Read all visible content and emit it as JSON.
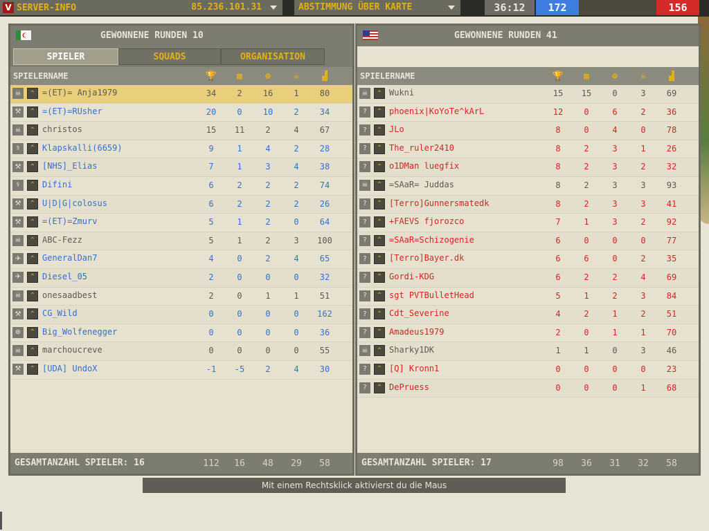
{
  "topbar": {
    "server_label": "SERVER-INFO",
    "server_ip": "85.236.101.31",
    "vote_label": "ABSTIMMUNG ÜBER KARTE",
    "timer": "36:12",
    "score_blue": "172",
    "score_red": "156"
  },
  "left": {
    "title": "GEWONNENE RUNDEN 10",
    "tabs": [
      "SPIELER",
      "SQUADS",
      "ORGANISATION"
    ],
    "col_name": "SPIELERNAME",
    "footer_label": "GESAMTANZAHL SPIELER: 16",
    "footer_values": [
      "112",
      "16",
      "48",
      "29",
      "58"
    ],
    "players": [
      {
        "name": "=(ET)= Anja1979",
        "vals": [
          "34",
          "2",
          "16",
          "1",
          "80"
        ],
        "color": "gray",
        "kit": "skull"
      },
      {
        "name": "=(ET)=RUsher",
        "vals": [
          "20",
          "0",
          "10",
          "2",
          "34"
        ],
        "color": "blue",
        "kit": "wrench"
      },
      {
        "name": "christos",
        "vals": [
          "15",
          "11",
          "2",
          "4",
          "67"
        ],
        "color": "gray",
        "kit": "skull"
      },
      {
        "name": "Klapskalli(6659)",
        "vals": [
          "9",
          "1",
          "4",
          "2",
          "28"
        ],
        "color": "blue",
        "kit": "med"
      },
      {
        "name": "[NHS]_Elias",
        "vals": [
          "7",
          "1",
          "3",
          "4",
          "38"
        ],
        "color": "blue",
        "kit": "wrench"
      },
      {
        "name": "Difini",
        "vals": [
          "6",
          "2",
          "2",
          "2",
          "74"
        ],
        "color": "blue",
        "kit": "med"
      },
      {
        "name": "U|D|G|colosus",
        "vals": [
          "6",
          "2",
          "2",
          "2",
          "26"
        ],
        "color": "blue",
        "kit": "wrench"
      },
      {
        "name": "=(ET)=Zmurv",
        "vals": [
          "5",
          "1",
          "2",
          "0",
          "64"
        ],
        "color": "blue",
        "kit": "wrench"
      },
      {
        "name": "ABC-Fezz",
        "vals": [
          "5",
          "1",
          "2",
          "3",
          "100"
        ],
        "color": "gray",
        "kit": "skull"
      },
      {
        "name": "GeneralDan7",
        "vals": [
          "4",
          "0",
          "2",
          "4",
          "65"
        ],
        "color": "blue",
        "kit": "plane"
      },
      {
        "name": "Diesel_05",
        "vals": [
          "2",
          "0",
          "0",
          "0",
          "32"
        ],
        "color": "blue",
        "kit": "plane"
      },
      {
        "name": "onesaadbest",
        "vals": [
          "2",
          "0",
          "1",
          "1",
          "51"
        ],
        "color": "gray",
        "kit": "skull"
      },
      {
        "name": "CG_Wild",
        "vals": [
          "0",
          "0",
          "0",
          "0",
          "162"
        ],
        "color": "blue",
        "kit": "wrench"
      },
      {
        "name": "Big_Wolfenegger",
        "vals": [
          "0",
          "0",
          "0",
          "0",
          "36"
        ],
        "color": "blue",
        "kit": "target"
      },
      {
        "name": "marchoucreve",
        "vals": [
          "0",
          "0",
          "0",
          "0",
          "55"
        ],
        "color": "gray",
        "kit": "skull"
      },
      {
        "name": "[UDA] UndoX",
        "vals": [
          "-1",
          "-5",
          "2",
          "4",
          "30"
        ],
        "color": "blue",
        "kit": "wrench"
      }
    ]
  },
  "right": {
    "title": "GEWONNENE RUNDEN 41",
    "col_name": "SPIELERNAME",
    "footer_label": "GESAMTANZAHL SPIELER: 17",
    "footer_values": [
      "98",
      "36",
      "31",
      "32",
      "58"
    ],
    "players": [
      {
        "name": "Wukni",
        "vals": [
          "15",
          "15",
          "0",
          "3",
          "69"
        ],
        "color": "gray",
        "kit": "skull"
      },
      {
        "name": "phoenix|KoYoTe^kArL",
        "vals": [
          "12",
          "0",
          "6",
          "2",
          "36"
        ],
        "color": "red",
        "kit": "unknown"
      },
      {
        "name": "JLo",
        "vals": [
          "8",
          "0",
          "4",
          "0",
          "78"
        ],
        "color": "red",
        "kit": "unknown"
      },
      {
        "name": "The_ruler2410",
        "vals": [
          "8",
          "2",
          "3",
          "1",
          "26"
        ],
        "color": "red",
        "kit": "unknown"
      },
      {
        "name": "o1DMan luegfix",
        "vals": [
          "8",
          "2",
          "3",
          "2",
          "32"
        ],
        "color": "red",
        "kit": "unknown"
      },
      {
        "name": "=SAaR= Juddas",
        "vals": [
          "8",
          "2",
          "3",
          "3",
          "93"
        ],
        "color": "gray",
        "kit": "skull"
      },
      {
        "name": "[Terro]Gunnersmatedk",
        "vals": [
          "8",
          "2",
          "3",
          "3",
          "41"
        ],
        "color": "red",
        "kit": "unknown"
      },
      {
        "name": "+FAEVS fjorozco",
        "vals": [
          "7",
          "1",
          "3",
          "2",
          "92"
        ],
        "color": "red",
        "kit": "unknown"
      },
      {
        "name": "=SAaR=Schizogenie",
        "vals": [
          "6",
          "0",
          "0",
          "0",
          "77"
        ],
        "color": "red",
        "kit": "unknown"
      },
      {
        "name": "[Terro]Bayer.dk",
        "vals": [
          "6",
          "6",
          "0",
          "2",
          "35"
        ],
        "color": "red",
        "kit": "unknown"
      },
      {
        "name": "Gordi-KDG",
        "vals": [
          "6",
          "2",
          "2",
          "4",
          "69"
        ],
        "color": "red",
        "kit": "unknown"
      },
      {
        "name": "sgt PVTBulletHead",
        "vals": [
          "5",
          "1",
          "2",
          "3",
          "84"
        ],
        "color": "red",
        "kit": "unknown"
      },
      {
        "name": "Cdt_Severine",
        "vals": [
          "4",
          "2",
          "1",
          "2",
          "51"
        ],
        "color": "red",
        "kit": "unknown"
      },
      {
        "name": "Amadeus1979",
        "vals": [
          "2",
          "0",
          "1",
          "1",
          "70"
        ],
        "color": "red",
        "kit": "unknown"
      },
      {
        "name": "Sharky1DK",
        "vals": [
          "1",
          "1",
          "0",
          "3",
          "46"
        ],
        "color": "gray",
        "kit": "skull"
      },
      {
        "name": "[Q] Kronn1",
        "vals": [
          "0",
          "0",
          "0",
          "0",
          "23"
        ],
        "color": "red",
        "kit": "unknown"
      },
      {
        "name": "DePruess",
        "vals": [
          "0",
          "0",
          "0",
          "1",
          "68"
        ],
        "color": "red",
        "kit": "unknown"
      }
    ]
  },
  "hint": "Mit einem Rechtsklick aktivierst du die Maus",
  "colors": {
    "team_blue": "#3470d0",
    "team_red": "#d52323",
    "accent": "#e3b019"
  }
}
